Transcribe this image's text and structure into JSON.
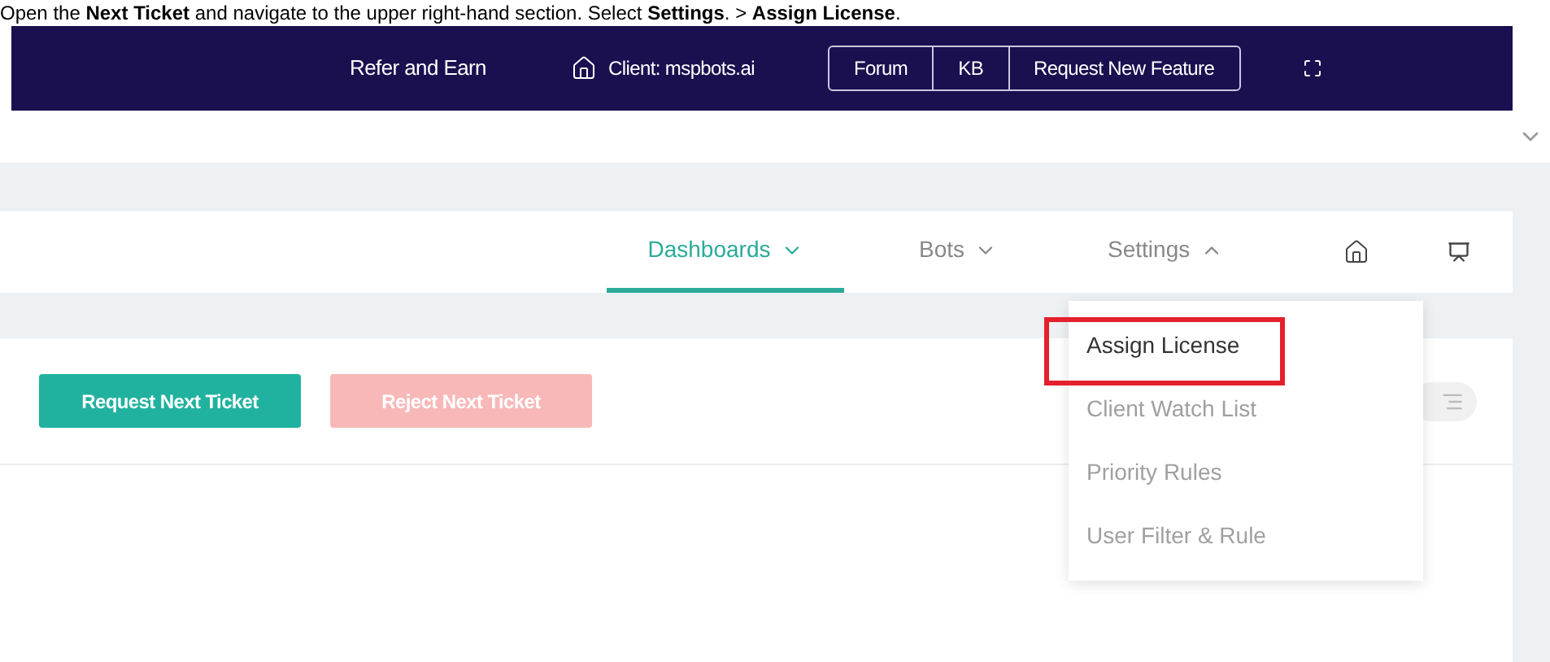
{
  "caption": "Open the **Next Ticket** and navigate to the upper right-hand section. Select **Settings**. > **Assign License**.",
  "topbar": {
    "refer": "Refer and Earn",
    "client": "Client: mspbots.ai",
    "links": [
      "Forum",
      "KB",
      "Request New Feature"
    ]
  },
  "tabs": [
    {
      "label": "Dashboards",
      "selected": true,
      "expanded": false
    },
    {
      "label": "Bots",
      "selected": false,
      "expanded": false
    },
    {
      "label": "Settings",
      "selected": false,
      "expanded": true
    }
  ],
  "menu": [
    {
      "label": "Assign License",
      "selected": true
    },
    {
      "label": "Client Watch List",
      "selected": false
    },
    {
      "label": "Priority Rules",
      "selected": false
    },
    {
      "label": "User Filter & Rule",
      "selected": false
    }
  ],
  "buttons": [
    {
      "label": "Request Next Ticket",
      "disabled": false
    },
    {
      "label": "Reject Next Ticket",
      "disabled": true
    }
  ]
}
